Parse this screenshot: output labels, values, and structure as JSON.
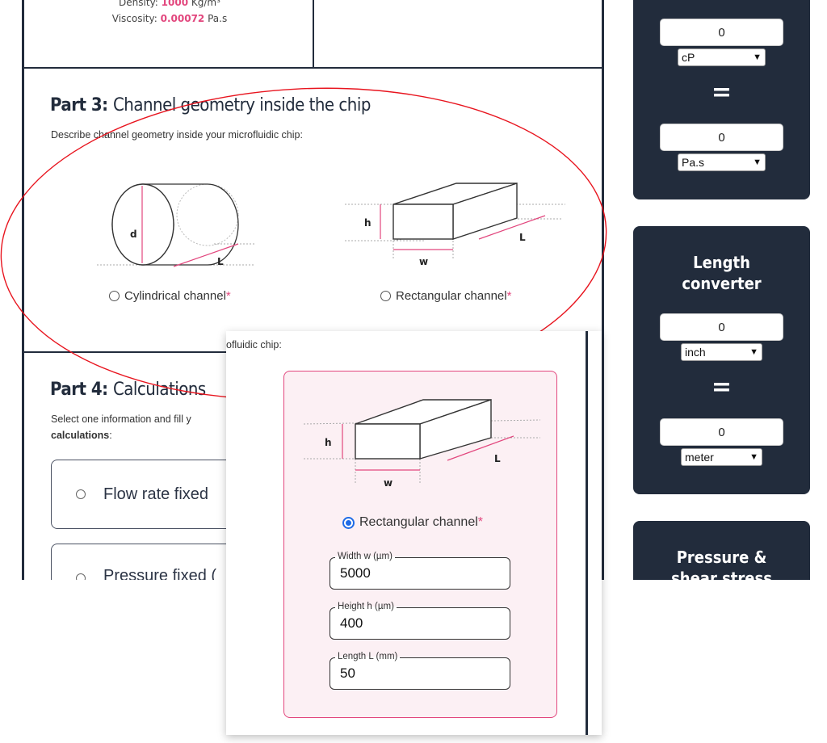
{
  "properties": {
    "density_label": "Density:",
    "density_value": "1000",
    "density_unit": "Kg/m³",
    "viscosity_label": "Viscosity:",
    "viscosity_value": "0.00072",
    "viscosity_unit": "Pa.s"
  },
  "part3": {
    "num": "Part 3:",
    "title": "Channel geometry inside the chip",
    "description": "Describe channel geometry inside your microfluidic chip:",
    "cyl_label": "Cylindrical channel",
    "rect_label": "Rectangular channel",
    "required_mark": "*",
    "diagram_labels": {
      "d": "d",
      "L": "L",
      "h": "h",
      "w": "w"
    }
  },
  "part4": {
    "num": "Part 4:",
    "title": "Calculations",
    "description_line1": "Select one information and fill y",
    "description_line2": "calculations",
    "description_colon": ":",
    "option1": "Flow rate fixed",
    "option2": "Pressure fixed ("
  },
  "sidebar": {
    "viscosity_converter": {
      "input1_value": "0",
      "unit1": "cP",
      "equals": "=",
      "input2_value": "0",
      "unit2": "Pa.s"
    },
    "length_converter": {
      "title_line1": "Length",
      "title_line2": "converter",
      "input1_value": "0",
      "unit1": "inch",
      "equals": "=",
      "input2_value": "0",
      "unit2": "meter"
    },
    "pressure_card": {
      "title_line1": "Pressure &",
      "title_line2": "shear stress"
    }
  },
  "popup": {
    "header_text": "ofluidic chip:",
    "radio_label": "Rectangular channel",
    "required_mark": "*",
    "diagram_labels": {
      "h": "h",
      "w": "w",
      "L": "L"
    },
    "fields": [
      {
        "label": "Width w (µm)",
        "value": "5000"
      },
      {
        "label": "Height h (µm)",
        "value": "400"
      },
      {
        "label": "Length L (mm)",
        "value": "50"
      }
    ]
  },
  "colors": {
    "accent_pink": "#e2467d",
    "dark_navy": "#222c3c",
    "annotation_red": "#e8141e",
    "radio_blue": "#1e6be6"
  }
}
